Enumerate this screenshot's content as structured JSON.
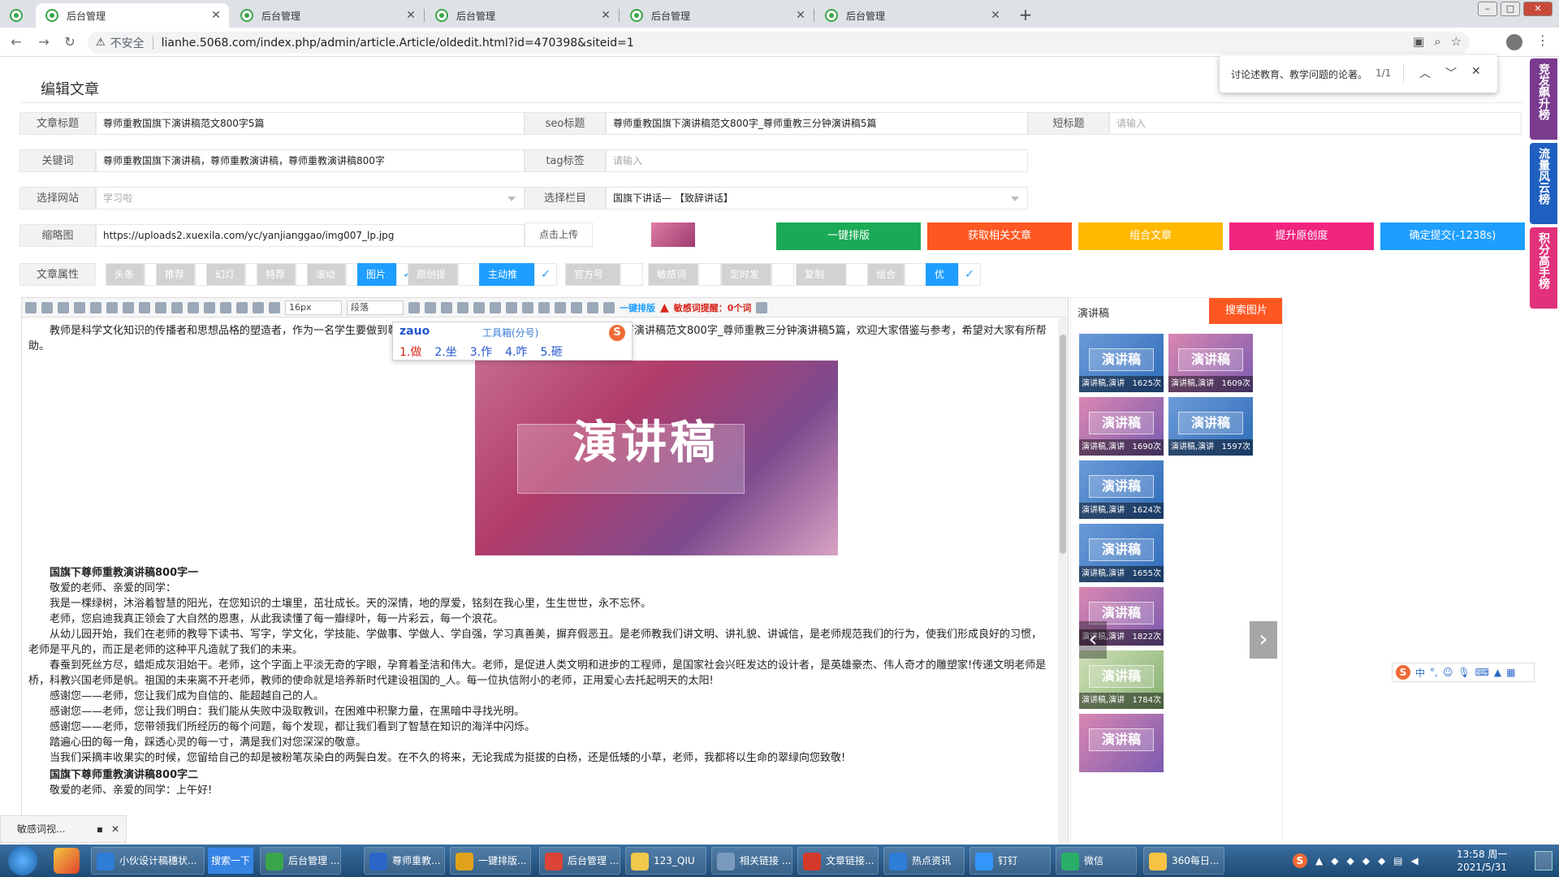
{
  "browser": {
    "tabs": [
      {
        "label": "后台管理",
        "active": true
      },
      {
        "label": "后台管理",
        "active": false
      },
      {
        "label": "后台管理",
        "active": false
      },
      {
        "label": "后台管理",
        "active": false
      },
      {
        "label": "后台管理",
        "active": false
      }
    ],
    "insecure_label": "不安全",
    "url": "lianhe.5068.com/index.php/admin/article.Article/oldedit.html?id=470398&siteid=1"
  },
  "findbar": {
    "query": "讨论述教育、教学问题的论著。",
    "count": "1/1"
  },
  "page": {
    "title": "编辑文章"
  },
  "form": {
    "row1": [
      {
        "label": "文章标题",
        "value": "尊师重教国旗下演讲稿范文800字5篇"
      },
      {
        "label": "seo标题",
        "value": "尊师重教国旗下演讲稿范文800字_尊师重教三分钟演讲稿5篇"
      },
      {
        "label": "短标题",
        "placeholder": "请输入"
      }
    ],
    "row2": [
      {
        "label": "关键词",
        "value": "尊师重教国旗下演讲稿，尊师重教演讲稿，尊师重教演讲稿800字"
      },
      {
        "label": "tag标签",
        "placeholder": "请输入"
      }
    ],
    "row3": [
      {
        "label": "选择网站",
        "value": "学习啦"
      },
      {
        "label": "选择栏目",
        "value": "国旗下讲话— 【致辞讲话】"
      }
    ],
    "row4": {
      "label": "缩略图",
      "value": "https://uploads2.xuexila.com/yc/yanjianggao/img007_lp.jpg",
      "upload": "点击上传"
    }
  },
  "actions": [
    {
      "label": "一键排版",
      "color": "#1aaa55"
    },
    {
      "label": "获取相关文章",
      "color": "#ff5722"
    },
    {
      "label": "组合文章",
      "color": "#ffb800"
    },
    {
      "label": "提升原创度",
      "color": "#f0247f"
    },
    {
      "label": "确定提交(-1238s)",
      "color": "#1e9fff"
    }
  ],
  "attributes": {
    "label": "文章属性",
    "items": [
      {
        "label": "头条",
        "on": false
      },
      {
        "label": "推荐",
        "on": false
      },
      {
        "label": "幻灯",
        "on": false
      },
      {
        "label": "特荐",
        "on": false
      },
      {
        "label": "滚动",
        "on": false
      },
      {
        "label": "图片",
        "on": true
      },
      {
        "label": "原创提交",
        "on": false
      },
      {
        "label": "主动推送",
        "on": true
      },
      {
        "label": "官方号提交",
        "on": false
      },
      {
        "label": "敏感词",
        "on": false
      },
      {
        "label": "定时发布",
        "on": false
      },
      {
        "label": "复制",
        "on": false
      },
      {
        "label": "组合",
        "on": false
      },
      {
        "label": "优化",
        "on": true
      }
    ]
  },
  "editor": {
    "font_size": "16px",
    "paragraph": "段落",
    "onekey": "一键排版",
    "sensitive": "敏感词提醒：0个词",
    "intro_before": "教师是科学文化知识的传播者和思想品格的塑造者，作为一名学生要做到尊师，",
    "ime_composition": "zauo",
    "intro_after": "下面是小编给大家整理的尊师重教国旗下演讲稿范文800字_尊师重教三分钟演讲稿5篇，欢迎大家借鉴与参考，希望对大家有所帮助。",
    "banner_title": "演讲稿",
    "ime": {
      "tool": "工具箱(分号)",
      "candidates": [
        "1.做",
        "2.坐",
        "3.作",
        "4.咋",
        "5.砸"
      ]
    },
    "heading1": "国旗下尊师重教演讲稿800字一",
    "paragraphs": [
      "敬爱的老师、亲爱的同学：",
      "我是一棵绿树，沐浴着智慧的阳光，在您知识的土壤里，茁壮成长。天的深情，地的厚爱，铭刻在我心里，生生世世，永不忘怀。",
      "老师，您启迪我真正领会了大自然的恩惠，从此我读懂了每一瓣绿叶，每一片彩云，每一个浪花。",
      "从幼儿园开始，我们在老师的教导下读书、写字，学文化，学技能、学做事、学做人、学自强，学习真善美，摒弃假恶丑。是老师教我们讲文明、讲礼貌、讲诚信，是老师规范我们的行为，使我们形成良好的习惯，老师是平凡的，而正是老师的这种平凡造就了我们的未来。",
      "春蚕到死丝方尽，蜡炬成灰泪始干。老师，这个字面上平淡无奇的字眼，孕育着圣洁和伟大。老师，是促进人类文明和进步的工程师，是国家社会兴旺发达的设计者，是英雄豪杰、伟人奇才的雕塑家!传递文明老师是桥，科教兴国老师是帆。祖国的未来离不开老师，教师的使命就是培养新时代建设祖国的_人。每一位执信附小的老师，正用爱心去托起明天的太阳!",
      "感谢您——老师，您让我们成为自信的、能超越自己的人。",
      "感谢您——老师，您让我们明白：我们能从失败中汲取教训，在困难中积聚力量，在黑暗中寻找光明。",
      "感谢您——老师，您带领我们所经历的每个问题，每个发现，都让我们看到了智慧在知识的海洋中闪烁。",
      "踏遍心田的每一角，踩透心灵的每一寸，满是我们对您深深的敬意。",
      "当我们采摘丰收果实的时候，您留给自己的却是被粉笔灰染白的两鬓白发。在不久的将来，无论我成为挺拔的白杨，还是低矮的小草，老师，我都将以生命的翠绿向您致敬!"
    ],
    "heading2": "国旗下尊师重教演讲稿800字二",
    "greeting": "敬爱的老师、亲爱的同学：上午好!"
  },
  "right_panel": {
    "title": "演讲稿",
    "search_button": "搜索图片",
    "thumbs": [
      {
        "title": "演讲稿",
        "caption": "演讲稿,演讲",
        "count": "1625次"
      },
      {
        "title": "演讲稿",
        "caption": "演讲稿,演讲",
        "count": "1609次"
      },
      {
        "title": "演讲稿",
        "caption": "演讲稿,演讲",
        "count": "1690次"
      },
      {
        "title": "演讲稿",
        "caption": "演讲稿,演讲",
        "count": "1597次"
      },
      {
        "title": "演讲稿",
        "caption": "演讲稿,演讲",
        "count": "1624次"
      },
      {
        "title": "演讲稿",
        "caption": "演讲稿,演讲",
        "count": "1655次"
      },
      {
        "title": "演讲稿",
        "caption": "演讲稿,演讲",
        "count": "1822次"
      },
      {
        "title": "演讲稿",
        "caption": "演讲稿,演讲",
        "count": "1784次"
      },
      {
        "title": "演讲稿",
        "caption": "",
        "count": ""
      }
    ]
  },
  "ribbons": [
    {
      "label": "竞发飙升榜",
      "color": "#7a3b8f"
    },
    {
      "label": "流量风云榜",
      "color": "#1f5fbf"
    },
    {
      "label": "积分高手榜",
      "color": "#e0317a"
    }
  ],
  "sensbar": {
    "label": "敏感词视..."
  },
  "taskbar": {
    "items": [
      {
        "label": "小伙设计稿穗状...",
        "color": "#2e7dd7"
      },
      {
        "label": "后台管理 ...",
        "color": "#3aa64a"
      },
      {
        "label": "尊师重教...",
        "color": "#2a66c8"
      },
      {
        "label": "一键排版...",
        "color": "#e0a21a"
      },
      {
        "label": "后台管理 ...",
        "color": "#db4437"
      },
      {
        "label": "123_QIU",
        "color": "#f0c94a"
      },
      {
        "label": "相关链接 ...",
        "color": "#7a9bbd"
      },
      {
        "label": "文章链接...",
        "color": "#d43a2b"
      },
      {
        "label": "热点资讯",
        "color": "#2e7dd7"
      },
      {
        "label": "钉钉",
        "color": "#3296fa"
      },
      {
        "label": "微信",
        "color": "#2aae67"
      },
      {
        "label": "360每日...",
        "color": "#f6c344"
      }
    ],
    "search_button": "搜索一下",
    "time": "13:58 周一",
    "date": "2021/5/31"
  }
}
